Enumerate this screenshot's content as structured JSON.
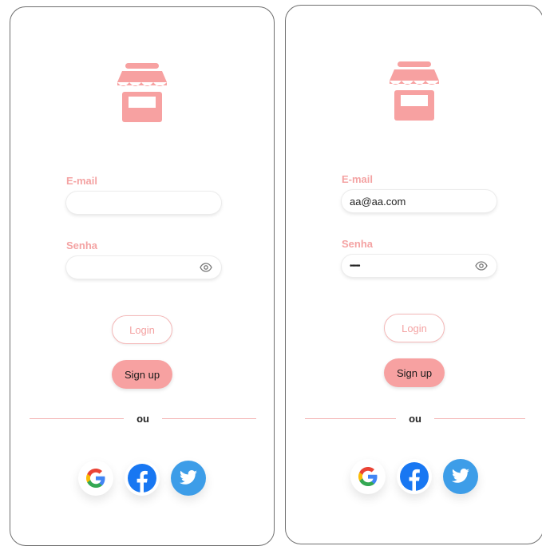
{
  "screens": [
    {
      "email_label": "E-mail",
      "email_value": "",
      "password_label": "Senha",
      "password_value": "",
      "login_label": "Login",
      "signup_label": "Sign up",
      "divider_text": "ou"
    },
    {
      "email_label": "E-mail",
      "email_value": "aa@aa.com",
      "password_label": "Senha",
      "password_value": "•••••",
      "login_label": "Login",
      "signup_label": "Sign up",
      "divider_text": "ou"
    }
  ],
  "icons": {
    "logo": "storefront-icon",
    "password_toggle": "eye-icon",
    "social": [
      "google-icon",
      "facebook-icon",
      "twitter-icon"
    ]
  },
  "colors": {
    "accent": "#f7a1a1",
    "label": "#f4a3a3",
    "facebook": "#1877f2",
    "twitter": "#3d9de8"
  }
}
